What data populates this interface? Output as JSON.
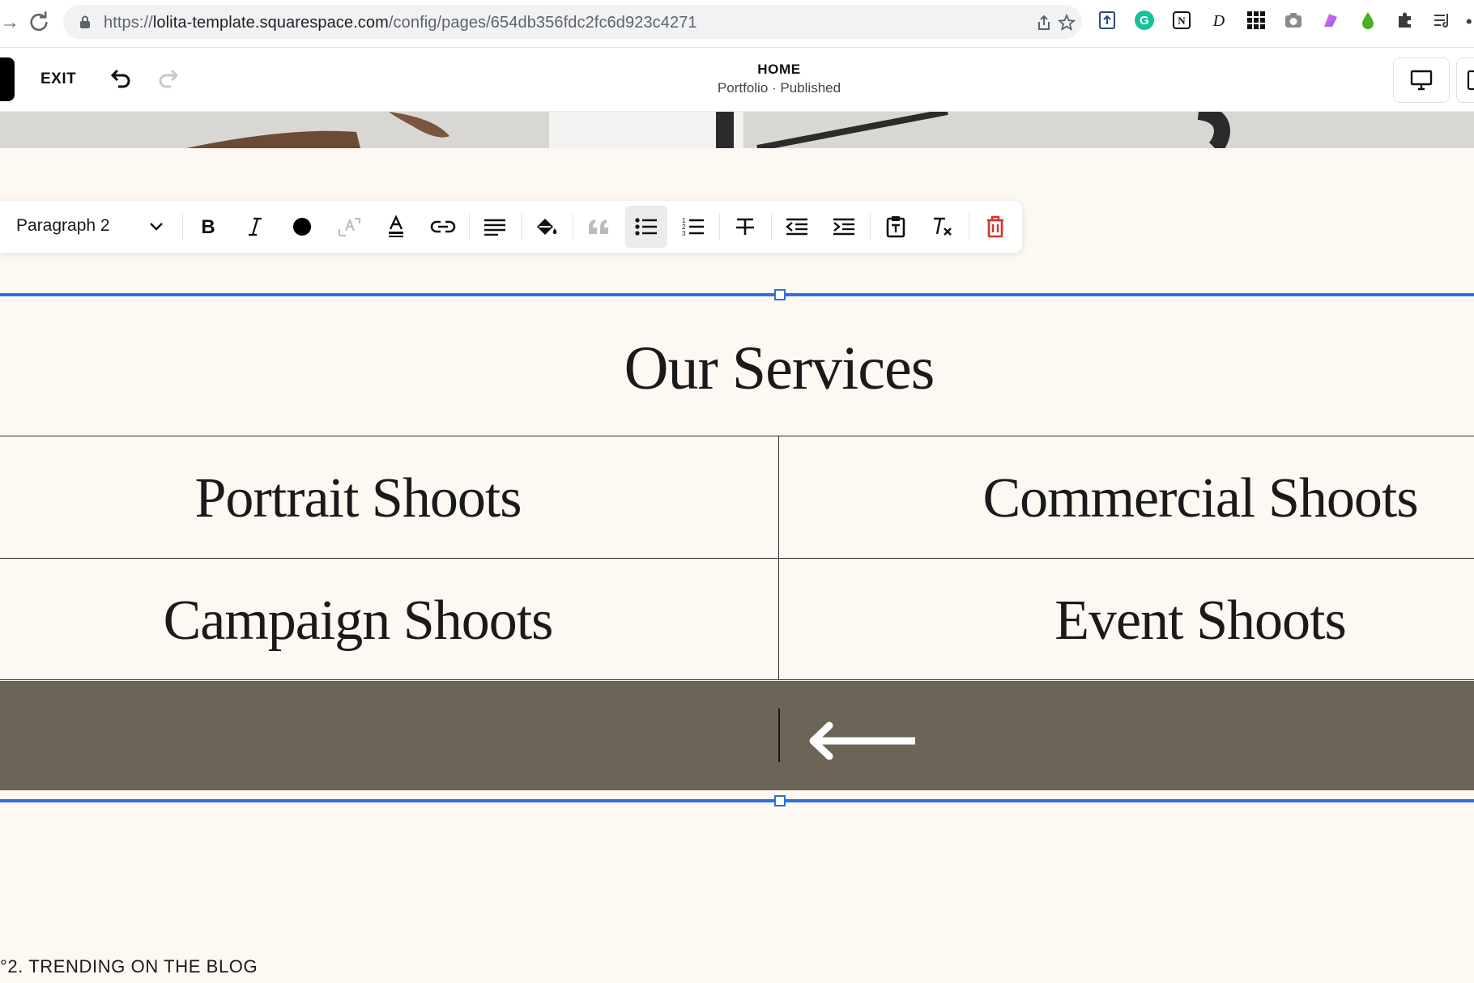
{
  "browser": {
    "url_prefix": "https://",
    "url_domain": "lolita-template.squarespace.com",
    "url_path": "/config/pages/654db356fdc2fc6d923c4271",
    "extensions": [
      "upload-extension-icon",
      "grammarly-icon",
      "notion-icon",
      "d-extension-icon",
      "grid-apps-icon",
      "camera-icon",
      "gradient-extension-icon",
      "drop-extension-icon",
      "puzzle-icon",
      "reading-list-icon"
    ]
  },
  "editor": {
    "exit_label": "EXIT",
    "page_title": "HOME",
    "page_subtitle": "Portfolio · Published"
  },
  "toolbar": {
    "style_value": "Paragraph 2",
    "buttons": [
      "bold",
      "italic",
      "text-color",
      "superscript",
      "highlight-color",
      "link",
      "align",
      "fill",
      "quote",
      "bulleted-list",
      "numbered-list",
      "strikethrough",
      "outdent",
      "indent",
      "paste",
      "clear-format",
      "delete"
    ],
    "active": "bulleted-list",
    "delete_color": "#d0342c"
  },
  "services": {
    "title": "Our Services",
    "items": [
      "Portrait Shoots",
      "Commercial Shoots",
      "Campaign Shoots",
      "Event Shoots"
    ]
  },
  "footer_section": {
    "blog_label": "°2. TRENDING ON THE BLOG"
  },
  "colors": {
    "accent_blue": "#2f6fe0",
    "page_bg": "#fdf8f1",
    "band": "#6c6457"
  }
}
